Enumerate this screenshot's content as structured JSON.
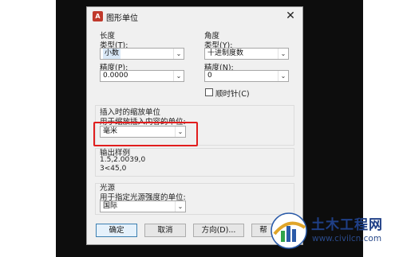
{
  "dialog": {
    "title": "图形单位",
    "app_icon_text": "A",
    "close_glyph": "✕"
  },
  "length": {
    "header": "长度",
    "type_label": "类型(T):",
    "type_value": "小数",
    "precision_label": "精度(P):",
    "precision_value": "0.0000"
  },
  "angle": {
    "header": "角度",
    "type_label": "类型(Y):",
    "type_value": "十进制度数",
    "precision_label": "精度(N):",
    "precision_value": "0",
    "clockwise_label": "顺时针(C)",
    "clockwise_checked": false
  },
  "insert_scale": {
    "header": "插入时的缩放单位",
    "label": "用于缩放插入内容的单位:",
    "value": "毫米"
  },
  "output_sample": {
    "header": "输出样例",
    "line1": "1.5,2.0039,0",
    "line2": "3<45,0"
  },
  "lighting": {
    "header": "光源",
    "label": "用于指定光源强度的单位:",
    "value": "国际"
  },
  "buttons": {
    "ok": "确定",
    "cancel": "取消",
    "direction": "方向(D)...",
    "help": "帮"
  },
  "combo_arrow_glyph": "⌄",
  "watermark": {
    "title": "土木工程网",
    "url": "www.civilcn.com"
  },
  "colors": {
    "highlight_box": "#e11d1d",
    "watermark_text": "#1f3f86"
  }
}
